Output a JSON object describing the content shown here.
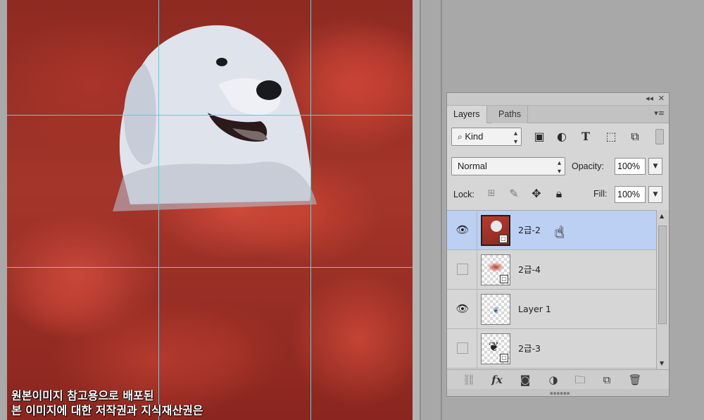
{
  "canvas": {
    "caption_line1": "원본이미지 참고용으로 배포된",
    "caption_line2": "본 이미지에 대한 저작권과 지식재산권은",
    "guide_color": "#4fd6e0"
  },
  "panel": {
    "collapse_glyph": "◂◂",
    "close_glyph": "✕",
    "menu_glyph": "▾≡",
    "tabs": [
      {
        "label": "Layers",
        "active": true
      },
      {
        "label": "Paths",
        "active": false
      }
    ],
    "filter": {
      "label": "Kind",
      "icons": [
        "image-filter-icon",
        "adjustment-filter-icon",
        "type-filter-icon",
        "shape-filter-icon",
        "smart-object-filter-icon",
        "filter-toggle-icon"
      ]
    },
    "blend_mode": "Normal",
    "opacity_label": "Opacity:",
    "opacity_value": "100%",
    "lock_label": "Lock:",
    "fill_label": "Fill:",
    "fill_value": "100%",
    "layers": [
      {
        "name": "2급-2",
        "visible": true,
        "selected": true
      },
      {
        "name": "2급-4",
        "visible": false,
        "selected": false
      },
      {
        "name": "Layer 1",
        "visible": true,
        "selected": false
      },
      {
        "name": "2급-3",
        "visible": false,
        "selected": false
      }
    ],
    "bottom_icons": [
      "link-layers-icon",
      "fx-icon",
      "add-mask-icon",
      "adjustment-layer-icon",
      "new-group-icon",
      "new-layer-icon",
      "trash-icon"
    ],
    "fx_label": "fx"
  },
  "colors": {
    "selection": "#bcd0f4",
    "panel_bg": "#d6d6d6"
  }
}
